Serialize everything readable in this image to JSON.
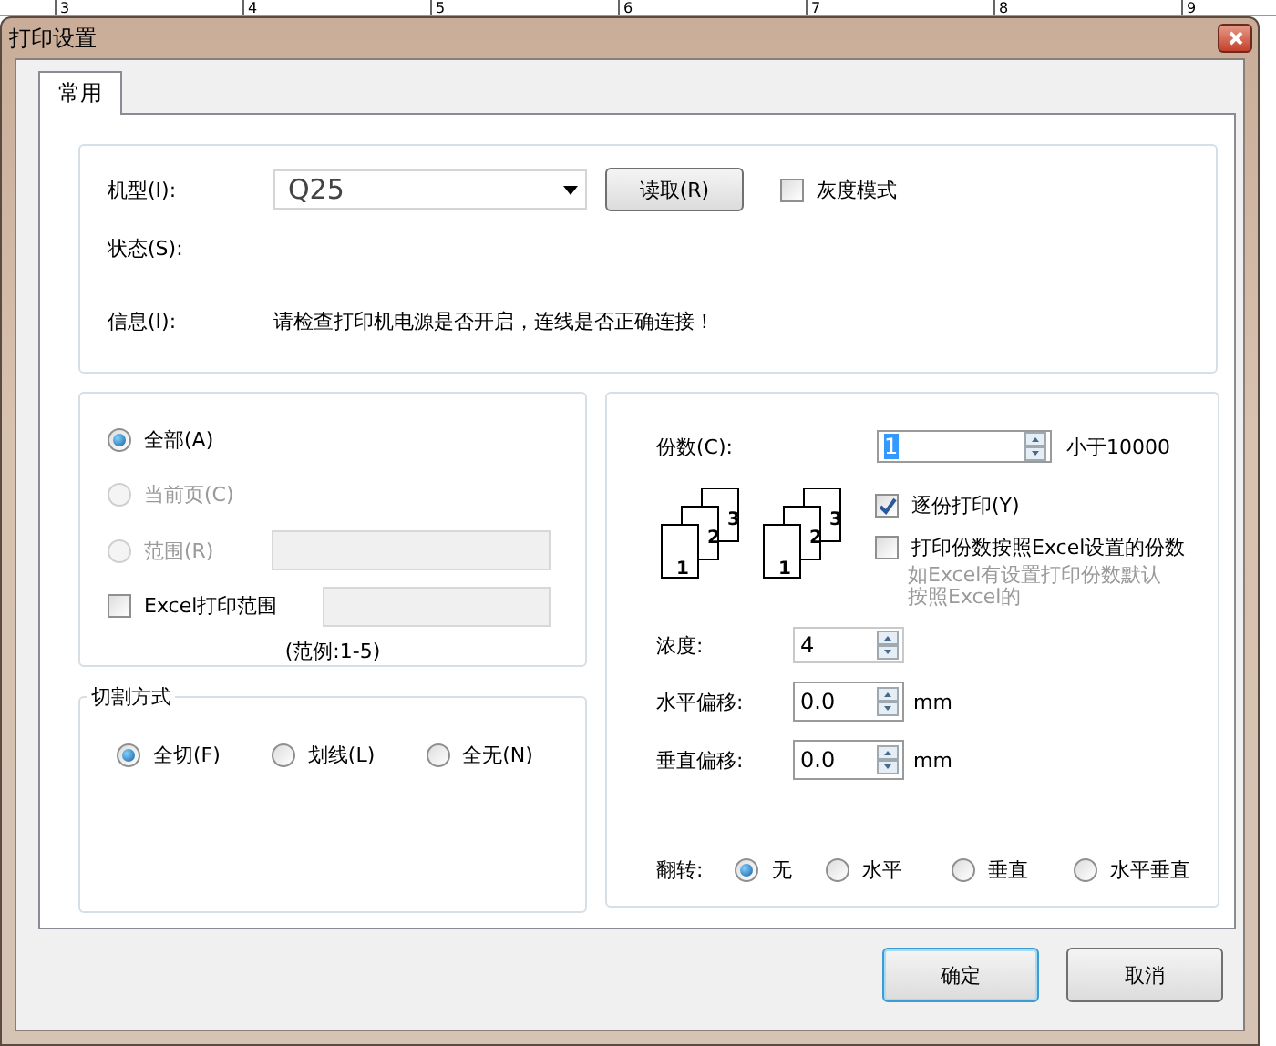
{
  "ruler": {
    "ticks": [
      "3",
      "4",
      "5",
      "6",
      "7",
      "8",
      "9"
    ]
  },
  "window": {
    "title": "打印设置"
  },
  "tabs": [
    {
      "label": "常用",
      "selected": true
    }
  ],
  "printer": {
    "model_label": "机型(I):",
    "model": "Q25",
    "read_button": "读取(R)",
    "grayscale": {
      "label": "灰度模式",
      "checked": false
    },
    "status_label": "状态(S):",
    "info_label": "信息(I):",
    "info": "请检查打印机电源是否开启，连线是否正确连接！"
  },
  "range": {
    "options": [
      {
        "label": "全部(A)",
        "selected": true,
        "disabled": false
      },
      {
        "label": "当前页(C)",
        "selected": false,
        "disabled": true
      },
      {
        "label": "范围(R)",
        "selected": false,
        "disabled": true
      }
    ],
    "excel": {
      "label": "Excel打印范围",
      "checked": false
    },
    "example": "(范例:1-5)"
  },
  "cut": {
    "title": "切割方式",
    "options": [
      {
        "label": "全切(F)",
        "selected": true
      },
      {
        "label": "划线(L)",
        "selected": false
      },
      {
        "label": "全无(N)",
        "selected": false
      }
    ]
  },
  "copies": {
    "label": "份数(C):",
    "value": "1",
    "hint": "小于10000",
    "page_sets": [
      [
        "1",
        "2",
        "3"
      ],
      [
        "1",
        "2",
        "3"
      ]
    ],
    "collate": {
      "label": "逐份打印(Y)",
      "checked": true
    },
    "use_excel": {
      "label": "打印份数按照Excel设置的份数",
      "checked": false
    },
    "note": "如Excel有设置打印份数默认按照Excel的"
  },
  "density": {
    "label": "浓度:",
    "value": "4"
  },
  "offsets": [
    {
      "label": "水平偏移:",
      "value": "0.0",
      "unit": "mm"
    },
    {
      "label": "垂直偏移:",
      "value": "0.0",
      "unit": "mm"
    }
  ],
  "flip": {
    "label": "翻转:",
    "options": [
      {
        "label": "无",
        "selected": true
      },
      {
        "label": "水平",
        "selected": false
      },
      {
        "label": "垂直",
        "selected": false
      },
      {
        "label": "水平垂直",
        "selected": false
      }
    ]
  },
  "buttons": [
    {
      "label": "确定",
      "kind": "default"
    },
    {
      "label": "取消",
      "kind": "normal"
    }
  ]
}
